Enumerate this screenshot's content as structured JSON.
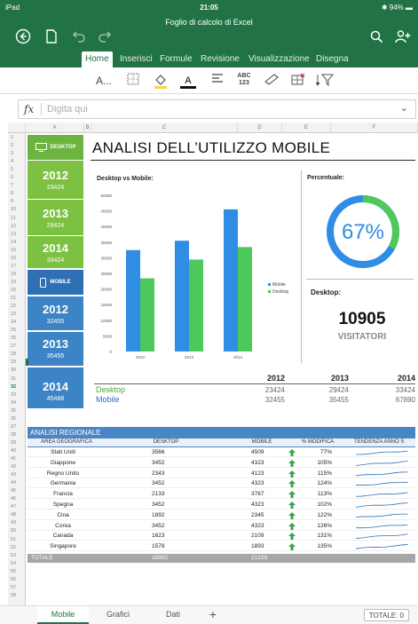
{
  "status_bar": {
    "device": "iPad",
    "time": "21:05",
    "battery": "94%"
  },
  "app": {
    "doc_title": "Foglio di calcolo di Excel"
  },
  "tabs": [
    {
      "label": "Home",
      "active": true
    },
    {
      "label": "Inserisci"
    },
    {
      "label": "Formule"
    },
    {
      "label": "Revisione"
    },
    {
      "label": "Visualizzazione"
    },
    {
      "label": "Disegna"
    }
  ],
  "ribbon": {
    "abc_label": "ABC",
    "abc_num": "123",
    "font_label": "A...",
    "font_color_label": "A"
  },
  "formula_bar": {
    "fx": "fx",
    "placeholder": "Digita qui"
  },
  "columns": [
    "A",
    "B",
    "C",
    "D",
    "E",
    "F"
  ],
  "sidebar": {
    "desktop_label": "DESKTOP",
    "mobile_label": "MOBILE",
    "desktop_years": [
      {
        "year": "2012",
        "value": "23424"
      },
      {
        "year": "2013",
        "value": "29424"
      },
      {
        "year": "2014",
        "value": "33424"
      }
    ],
    "mobile_years": [
      {
        "year": "2012",
        "value": "32455"
      },
      {
        "year": "2013",
        "value": "35455"
      },
      {
        "year": "2014",
        "value": "45488"
      }
    ]
  },
  "page_title": "ANALISI DELL’UTILIZZO MOBILE",
  "chart_data": {
    "type": "bar",
    "title": "Desktop vs Mobile:",
    "categories": [
      "2012",
      "2013",
      "2014"
    ],
    "series": [
      {
        "name": "Mobile",
        "color": "#2f8de4",
        "values": [
          32455,
          35455,
          45488
        ]
      },
      {
        "name": "Desktop",
        "color": "#4cc95a",
        "values": [
          23424,
          29424,
          33424
        ]
      }
    ],
    "ylim": [
      0,
      50000
    ],
    "yticks": [
      "0",
      "5000",
      "10000",
      "15000",
      "20000",
      "25000",
      "30000",
      "35000",
      "40000",
      "45000",
      "50000"
    ],
    "legend": "right"
  },
  "percentage": {
    "title": "Percentuale:",
    "value": "67%",
    "fraction": 0.67
  },
  "desktop_summary": {
    "label": "Desktop:",
    "number": "10905",
    "sub": "VISITATORI"
  },
  "summary_table": {
    "years": [
      "2012",
      "2013",
      "2014"
    ],
    "rows": [
      {
        "label": "Desktop",
        "color": "#4aa832",
        "values": [
          "23424",
          "29424",
          "33424"
        ]
      },
      {
        "label": "Mobile",
        "color": "#2f6fb5",
        "values": [
          "32455",
          "35455",
          "67890"
        ]
      }
    ]
  },
  "regional": {
    "title": "ANALISI REGIONALE",
    "headers": [
      "AREA GEOGRAFICA",
      "DESKTOP",
      "MOBILE",
      "% MODIFICA",
      "TENDENZA ANNO S"
    ],
    "rows": [
      {
        "area": "Stati Uniti",
        "desktop": "3566",
        "mobile": "4509",
        "pct": "77%"
      },
      {
        "area": "Giappone",
        "desktop": "3452",
        "mobile": "4323",
        "pct": "105%"
      },
      {
        "area": "Regno Unito",
        "desktop": "2343",
        "mobile": "4123",
        "pct": "115%"
      },
      {
        "area": "Germania",
        "desktop": "3452",
        "mobile": "4323",
        "pct": "124%"
      },
      {
        "area": "Francia",
        "desktop": "2133",
        "mobile": "3767",
        "pct": "113%"
      },
      {
        "area": "Spegna",
        "desktop": "3452",
        "mobile": "4323",
        "pct": "102%"
      },
      {
        "area": "Cina",
        "desktop": "1892",
        "mobile": "2345",
        "pct": "122%"
      },
      {
        "area": "Corea",
        "desktop": "3452",
        "mobile": "4323",
        "pct": "126%"
      },
      {
        "area": "Canada",
        "desktop": "1623",
        "mobile": "2109",
        "pct": "131%"
      },
      {
        "area": "Singapore",
        "desktop": "1578",
        "mobile": "1893",
        "pct": "135%"
      }
    ],
    "total": {
      "label": "TOTALE",
      "desktop": "18902",
      "mobile": "21229"
    }
  },
  "sheet_tabs": [
    {
      "label": "Mobile",
      "active": true
    },
    {
      "label": "Grafici"
    },
    {
      "label": "Dati"
    }
  ],
  "add_sheet": "+",
  "status_total": "TOTALE: 0",
  "colors": {
    "excel_green": "#217346",
    "desktop_green": "#7cc142",
    "mobile_blue": "#3d84c6"
  }
}
